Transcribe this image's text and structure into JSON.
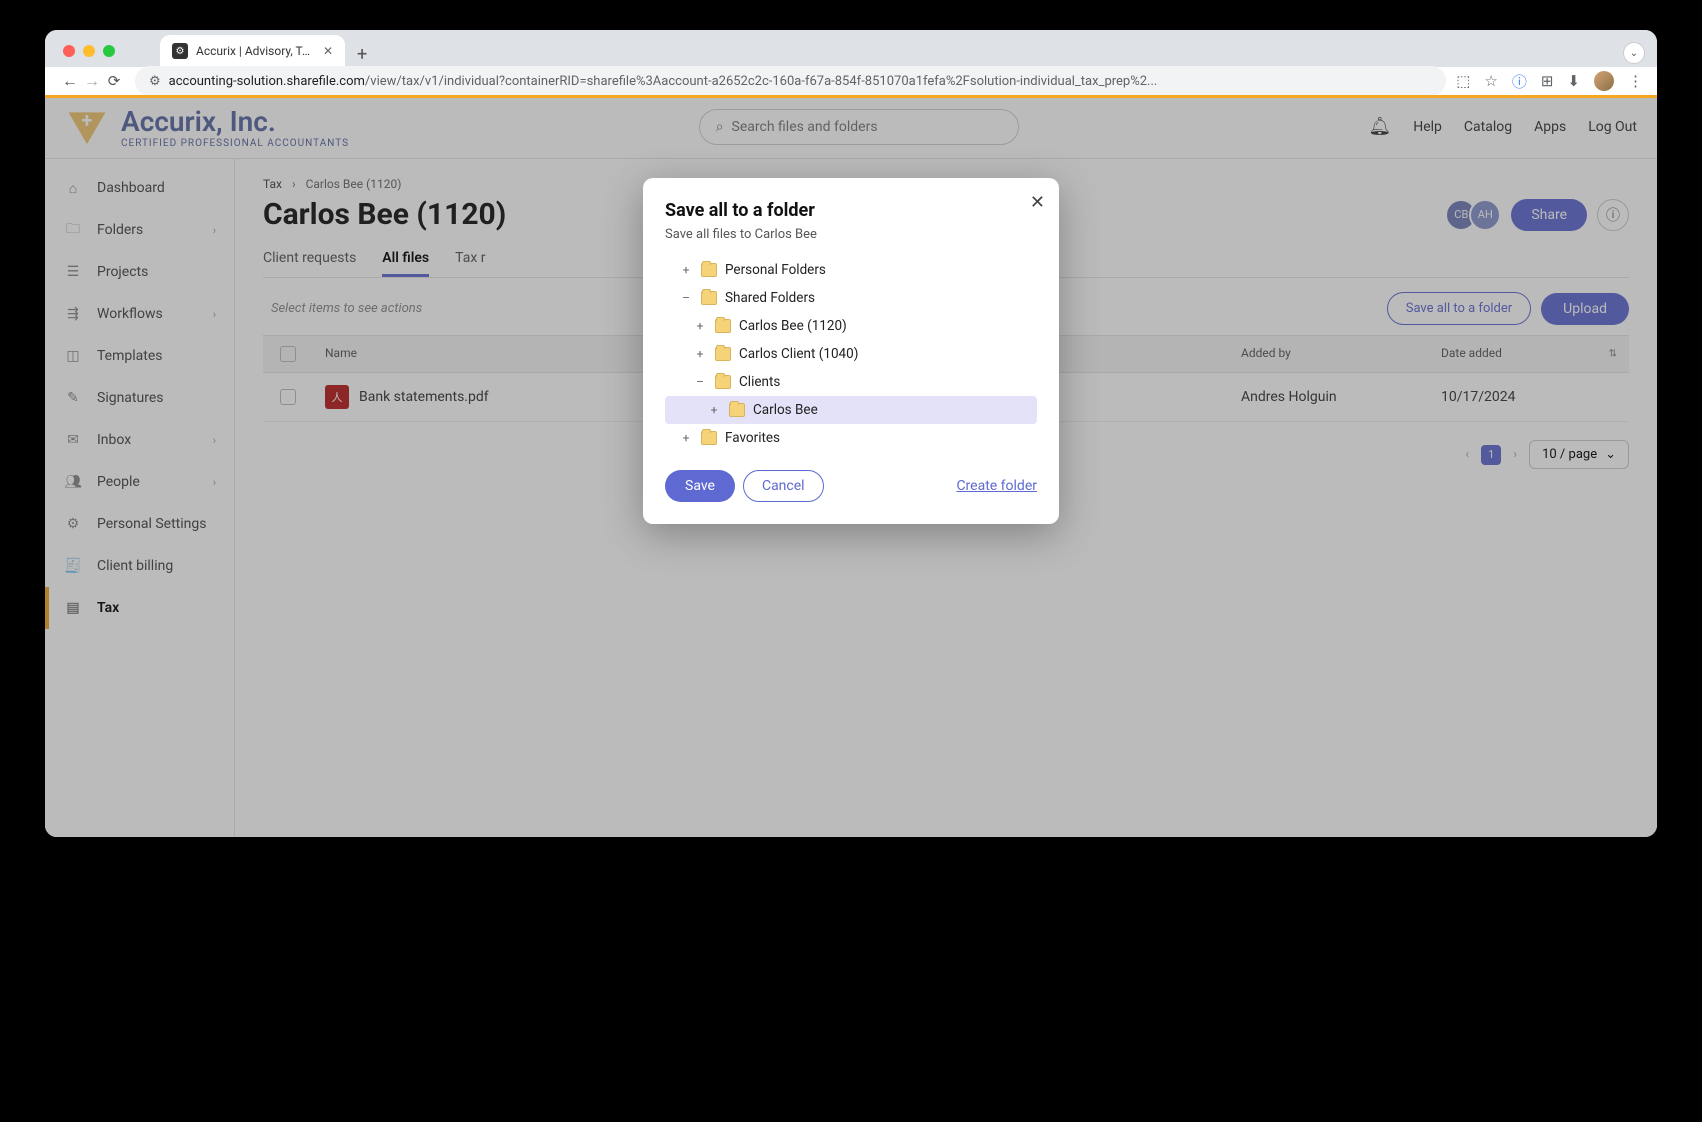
{
  "browser": {
    "tab_title": "Accurix | Advisory, Tax, and A",
    "url_host": "accounting-solution.sharefile.com",
    "url_path": "/view/tax/v1/individual?containerRID=sharefile%3Aaccount-a2652c2c-160a-f67a-854f-851070a1fefa%2Fsolution-individual_tax_prep%2..."
  },
  "brand": {
    "name": "Accurix, Inc.",
    "tagline": "CERTIFIED PROFESSIONAL ACCOUNTANTS"
  },
  "search": {
    "placeholder": "Search files and folders"
  },
  "header_links": {
    "help": "Help",
    "catalog": "Catalog",
    "apps": "Apps",
    "logout": "Log Out"
  },
  "sidebar": {
    "items": [
      {
        "label": "Dashboard",
        "icon": "home"
      },
      {
        "label": "Folders",
        "icon": "folder",
        "chevron": true
      },
      {
        "label": "Projects",
        "icon": "projects"
      },
      {
        "label": "Workflows",
        "icon": "workflow",
        "chevron": true
      },
      {
        "label": "Templates",
        "icon": "template"
      },
      {
        "label": "Signatures",
        "icon": "signature"
      },
      {
        "label": "Inbox",
        "icon": "inbox",
        "chevron": true
      },
      {
        "label": "People",
        "icon": "people",
        "chevron": true
      },
      {
        "label": "Personal Settings",
        "icon": "gear"
      },
      {
        "label": "Client billing",
        "icon": "billing"
      },
      {
        "label": "Tax",
        "icon": "tax",
        "active": true
      }
    ]
  },
  "breadcrumb": {
    "root": "Tax",
    "current": "Carlos Bee (1120)"
  },
  "page": {
    "title": "Carlos Bee (1120)"
  },
  "avatars": {
    "a1": "CB",
    "a2": "AH"
  },
  "buttons": {
    "share": "Share",
    "save_all": "Save all to a folder",
    "upload": "Upload"
  },
  "tabs": {
    "client_requests": "Client requests",
    "all_files": "All files",
    "tax_returns_truncated": "Tax r"
  },
  "hint": "Select items to see actions",
  "table": {
    "headers": {
      "name": "Name",
      "added_by": "Added by",
      "date_added": "Date added"
    },
    "rows": [
      {
        "name": "Bank statements.pdf",
        "added_by": "Andres Holguin",
        "date_added": "10/17/2024"
      }
    ]
  },
  "pagination": {
    "page": "1",
    "size": "10 / page"
  },
  "modal": {
    "title": "Save all to a folder",
    "subtitle": "Save all files to Carlos Bee",
    "tree": {
      "personal": "Personal Folders",
      "shared": "Shared Folders",
      "carlos_1120": "Carlos Bee (1120)",
      "carlos_1040": "Carlos Client (1040)",
      "clients": "Clients",
      "carlos_bee": "Carlos Bee",
      "favorites": "Favorites"
    },
    "save": "Save",
    "cancel": "Cancel",
    "create": "Create folder"
  }
}
